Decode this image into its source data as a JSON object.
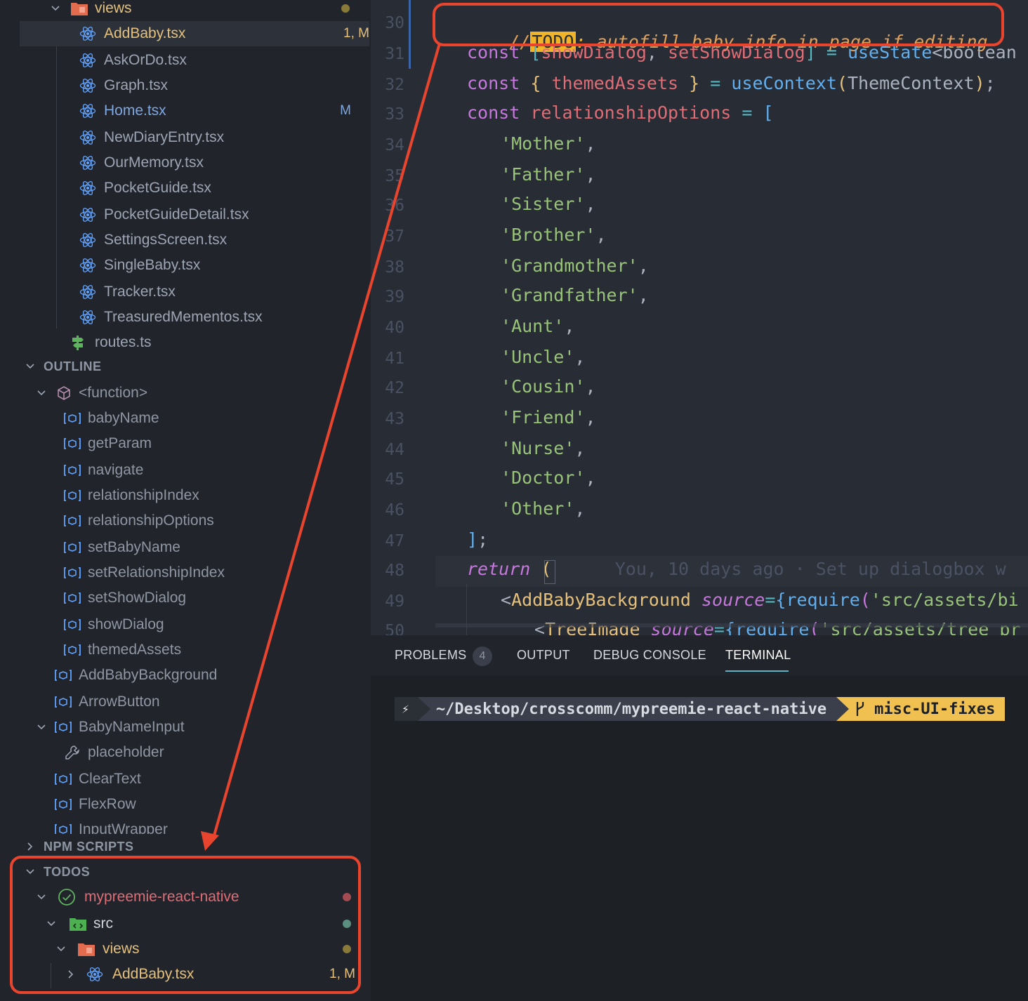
{
  "explorer": {
    "folder": {
      "name": "views"
    },
    "files": [
      {
        "name": "AddBaby.tsx",
        "status": "1, M"
      },
      {
        "name": "AskOrDo.tsx",
        "status": ""
      },
      {
        "name": "Graph.tsx",
        "status": ""
      },
      {
        "name": "Home.tsx",
        "status": "M"
      },
      {
        "name": "NewDiaryEntry.tsx",
        "status": ""
      },
      {
        "name": "OurMemory.tsx",
        "status": ""
      },
      {
        "name": "PocketGuide.tsx",
        "status": ""
      },
      {
        "name": "PocketGuideDetail.tsx",
        "status": ""
      },
      {
        "name": "SettingsScreen.tsx",
        "status": ""
      },
      {
        "name": "SingleBaby.tsx",
        "status": ""
      },
      {
        "name": "Tracker.tsx",
        "status": ""
      },
      {
        "name": "TreasuredMementos.tsx",
        "status": ""
      }
    ],
    "routes_file": "routes.ts"
  },
  "outline": {
    "title": "OUTLINE",
    "function_label": "<function>",
    "function_vars": [
      "babyName",
      "getParam",
      "navigate",
      "relationshipIndex",
      "relationshipOptions",
      "setBabyName",
      "setRelationshipIndex",
      "setShowDialog",
      "showDialog",
      "themedAssets"
    ],
    "components": [
      "AddBabyBackground",
      "ArrowButton",
      "BabyNameInput"
    ],
    "baby_name_child": "placeholder",
    "more_components": [
      "ClearText",
      "FlexRow",
      "InputWrapper"
    ]
  },
  "npm_scripts": {
    "title": "NPM SCRIPTS"
  },
  "todos": {
    "title": "TODOS",
    "project": "mypreemie-react-native",
    "src": "src",
    "views": "views",
    "file": "AddBaby.tsx",
    "file_status": "1, M"
  },
  "editor": {
    "line_numbers": [
      "30",
      "31",
      "32",
      "33",
      "34",
      "35",
      "36",
      "37",
      "38",
      "39",
      "40",
      "41",
      "42",
      "43",
      "44",
      "45",
      "46",
      "47",
      "48",
      "49",
      "50"
    ],
    "todo_prefix": "//",
    "todo_tag": "TODO",
    "todo_colon": ":",
    "todo_text": " autofill baby info in page if editing",
    "relationship_options": [
      "Mother",
      "Father",
      "Sister",
      "Brother",
      "Grandmother",
      "Grandfather",
      "Aunt",
      "Uncle",
      "Cousin",
      "Friend",
      "Nurse",
      "Doctor",
      "Other"
    ],
    "blame": "You, 10 days ago · Set up dialogbox w"
  },
  "panel": {
    "tabs": [
      "PROBLEMS",
      "OUTPUT",
      "DEBUG CONSOLE",
      "TERMINAL"
    ],
    "problems_count": "4",
    "active_tab": "TERMINAL"
  },
  "terminal": {
    "prompt_symbol": "⚡",
    "path": "~/Desktop/crosscomm/mypreemie-react-native",
    "branch": "misc-UI-fixes"
  },
  "colors": {
    "annotation": "#e8442e",
    "modified": "#e5c07b",
    "accent_tab": "#5db3c4"
  }
}
